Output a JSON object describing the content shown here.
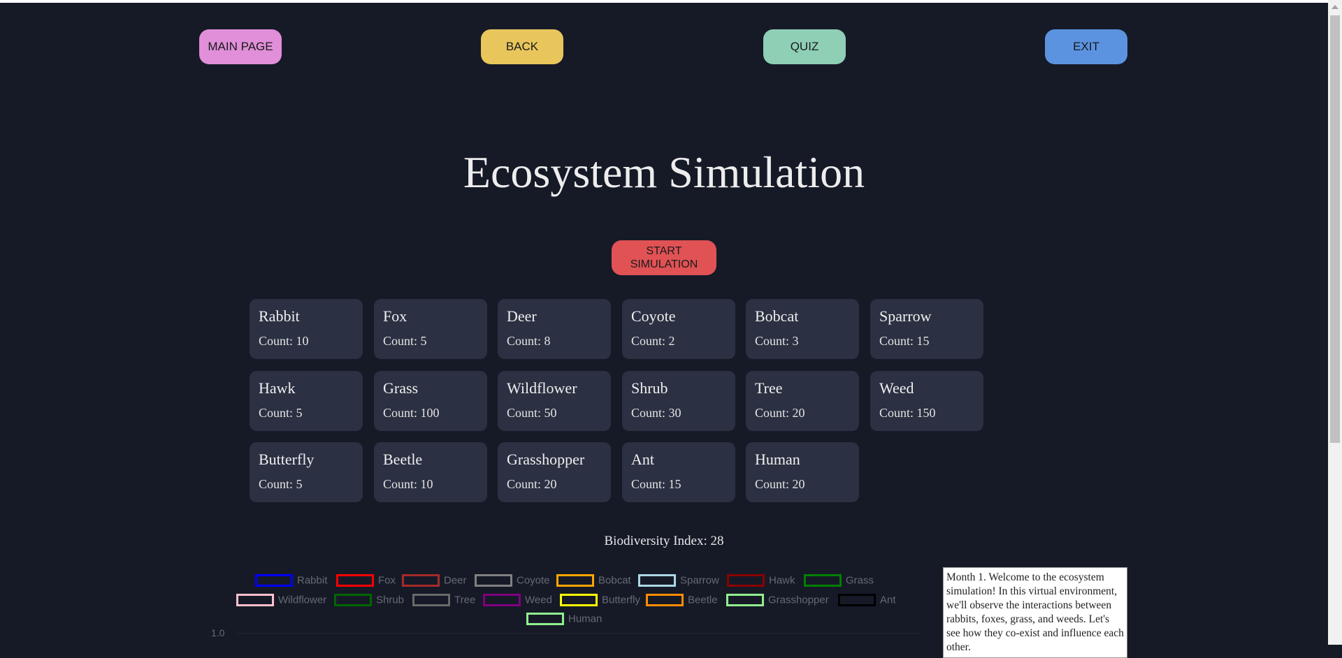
{
  "nav": {
    "main_page": "MAIN PAGE",
    "back": "BACK",
    "quiz": "QUIZ",
    "exit": "EXIT"
  },
  "title": "Ecosystem Simulation",
  "start_button": "START\nSIMULATION",
  "species": [
    {
      "name": "Rabbit",
      "count": "Count: 10"
    },
    {
      "name": "Fox",
      "count": "Count: 5"
    },
    {
      "name": "Deer",
      "count": "Count: 8"
    },
    {
      "name": "Coyote",
      "count": "Count: 2"
    },
    {
      "name": "Bobcat",
      "count": "Count: 3"
    },
    {
      "name": "Sparrow",
      "count": "Count: 15"
    },
    {
      "name": "Hawk",
      "count": "Count: 5"
    },
    {
      "name": "Grass",
      "count": "Count: 100"
    },
    {
      "name": "Wildflower",
      "count": "Count: 50"
    },
    {
      "name": "Shrub",
      "count": "Count: 30"
    },
    {
      "name": "Tree",
      "count": "Count: 20"
    },
    {
      "name": "Weed",
      "count": "Count: 150"
    },
    {
      "name": "Butterfly",
      "count": "Count: 5"
    },
    {
      "name": "Beetle",
      "count": "Count: 10"
    },
    {
      "name": "Grasshopper",
      "count": "Count: 20"
    },
    {
      "name": "Ant",
      "count": "Count: 15"
    },
    {
      "name": "Human",
      "count": "Count: 20"
    }
  ],
  "biodiversity": "Biodiversity Index: 28",
  "legend": [
    {
      "label": "Rabbit",
      "color": "#0000ff"
    },
    {
      "label": "Fox",
      "color": "#ff0000"
    },
    {
      "label": "Deer",
      "color": "#a52a2a"
    },
    {
      "label": "Coyote",
      "color": "#808080"
    },
    {
      "label": "Bobcat",
      "color": "#ffa500"
    },
    {
      "label": "Sparrow",
      "color": "#add8e6"
    },
    {
      "label": "Hawk",
      "color": "#8b0000"
    },
    {
      "label": "Grass",
      "color": "#008000"
    },
    {
      "label": "Wildflower",
      "color": "#ffc0cb"
    },
    {
      "label": "Shrub",
      "color": "#006400"
    },
    {
      "label": "Tree",
      "color": "#696969"
    },
    {
      "label": "Weed",
      "color": "#800080"
    },
    {
      "label": "Butterfly",
      "color": "#ffff00"
    },
    {
      "label": "Beetle",
      "color": "#ff8c00"
    },
    {
      "label": "Grasshopper",
      "color": "#90ee90"
    },
    {
      "label": "Ant",
      "color": "#000000"
    },
    {
      "label": "Human",
      "color": "#90ee90"
    }
  ],
  "chart": {
    "y_tick_top": "1.0"
  },
  "narration": "Month 1. Welcome to the ecosystem simulation! In this virtual environment, we'll observe the interactions between rabbits, foxes, grass, and weeds. Let's see how they co-exist and influence each other."
}
